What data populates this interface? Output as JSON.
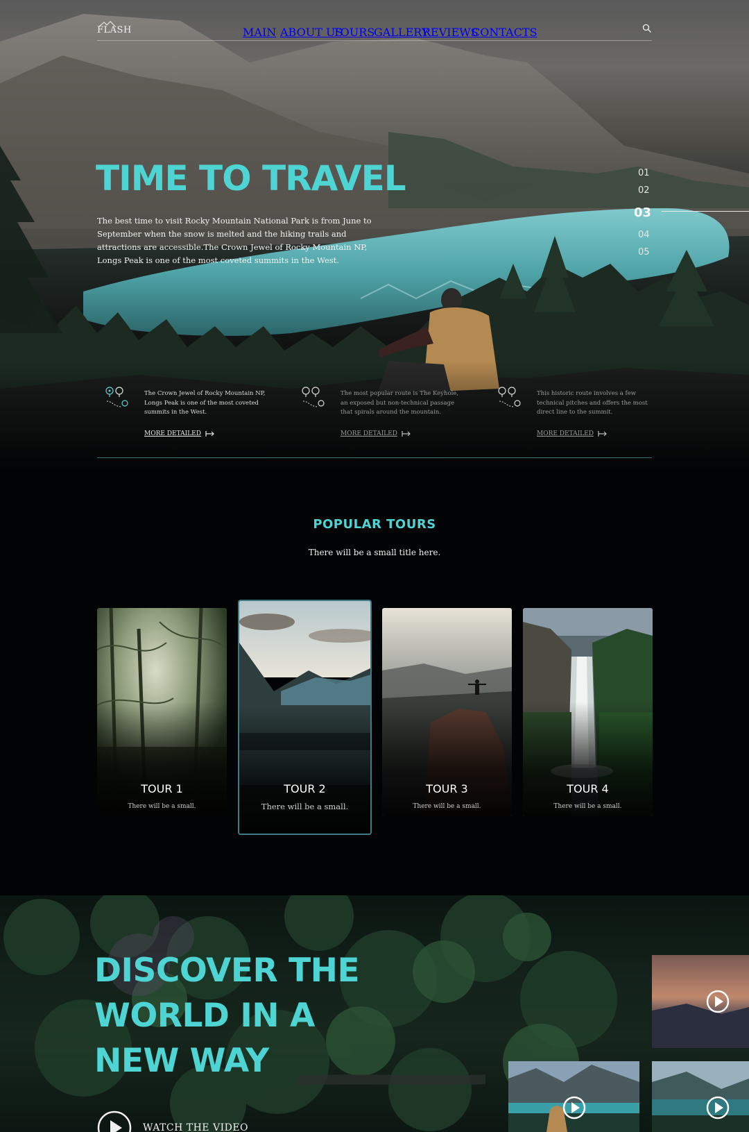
{
  "header": {
    "logo": "FLASH",
    "nav": [
      "MAIN",
      "ABOUT US",
      "TOURS",
      "GALLERY",
      "REVIEWS",
      "CONTACTS"
    ],
    "search_icon": "search-icon"
  },
  "hero": {
    "title": "TIME TO TRAVEL",
    "text": "The best time to visit Rocky Mountain National Park is from June to September when the snow is melted and the hiking trails and attractions are accessible.The Crown Jewel of Rocky Mountain NP, Longs Peak is one of the most coveted summits in the West.",
    "slides": [
      "01",
      "02",
      "03",
      "04",
      "05"
    ],
    "active_slide": "03",
    "features": [
      {
        "text": "The Crown Jewel of Rocky Mountain NP, Longs Peak is one of the most coveted summits in the West.",
        "more": "MORE DETAILED",
        "icon": "route-pin-icon"
      },
      {
        "text": "The most popular route is The Keyhole, an exposed but non-technical passage that spirals around the mountain.",
        "more": "MORE DETAILED",
        "icon": "route-pin-icon"
      },
      {
        "text": "This historic route involves a few technical pitches and offers the most direct line to the summit.",
        "more": "MORE DETAILED",
        "icon": "route-pin-icon"
      }
    ]
  },
  "tours": {
    "title": "POPULAR TOURS",
    "subtitle": "There will be a small title here.",
    "cards": [
      {
        "title": "TOUR 1",
        "sub": "There will be a small."
      },
      {
        "title": "TOUR 2",
        "sub": "There will be a small."
      },
      {
        "title": "TOUR 3",
        "sub": "There will be a small."
      },
      {
        "title": "TOUR 4",
        "sub": "There will be a small."
      }
    ]
  },
  "discover": {
    "title_lines": [
      "DISCOVER THE",
      "WORLD IN A",
      "NEW WAY"
    ],
    "watch_label": "WATCH THE VIDEO",
    "play_icon": "play-icon"
  },
  "colors": {
    "accent": "#4fd4d4",
    "divider": "#3d6e76",
    "featured_border": "#3f7c86"
  }
}
